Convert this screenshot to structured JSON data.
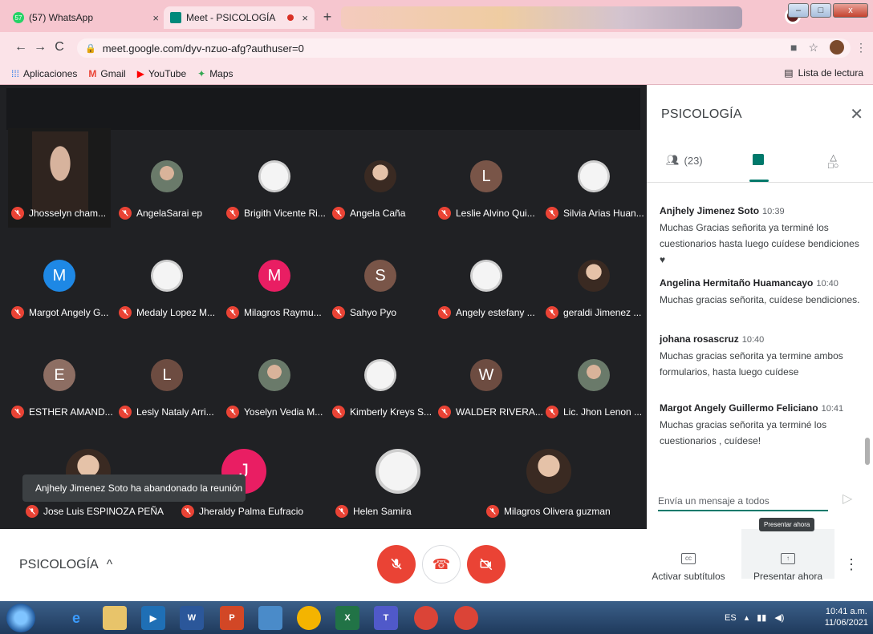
{
  "browser": {
    "tabs": [
      {
        "title": "(57) WhatsApp",
        "badge": "57"
      },
      {
        "title": "Meet - PSICOLOGÍA"
      }
    ],
    "url": "meet.google.com/dyv-nzuo-afg?authuser=0",
    "bookmarks": [
      "Aplicaciones",
      "Gmail",
      "YouTube",
      "Maps"
    ],
    "reading_list": "Lista de lectura"
  },
  "grid": {
    "rows": [
      [
        {
          "name": "Jhosselyn cham...",
          "avatar": "photo"
        },
        {
          "name": "AngelaSarai ep",
          "avatar": "photo"
        },
        {
          "name": "Brigith Vicente Ri...",
          "avatar": "photo"
        },
        {
          "name": "Angela Caña",
          "avatar": "photo"
        },
        {
          "name": "Leslie Alvino Qui...",
          "avatar": "letter",
          "letter": "L",
          "color": "#795548"
        },
        {
          "name": "Silvia Arias Huan...",
          "avatar": "photo"
        }
      ],
      [
        {
          "name": "Margot Angely G...",
          "avatar": "letter",
          "letter": "M",
          "color": "#1e88e5"
        },
        {
          "name": "Medaly Lopez M...",
          "avatar": "photo"
        },
        {
          "name": "Milagros Raymu...",
          "avatar": "letter",
          "letter": "M",
          "color": "#e91e63"
        },
        {
          "name": "Sahyo Pyo",
          "avatar": "letter",
          "letter": "S",
          "color": "#795548"
        },
        {
          "name": "Angely estefany ...",
          "avatar": "photo"
        },
        {
          "name": "geraldi Jimenez ...",
          "avatar": "photo"
        }
      ],
      [
        {
          "name": "ESTHER AMAND...",
          "avatar": "letter",
          "letter": "E",
          "color": "#8d6e63"
        },
        {
          "name": "Lesly Nataly Arri...",
          "avatar": "letter",
          "letter": "L",
          "color": "#6d4c41"
        },
        {
          "name": "Yoselyn Vedia M...",
          "avatar": "photo"
        },
        {
          "name": "Kimberly Kreys S...",
          "avatar": "photo"
        },
        {
          "name": "WALDER RIVERA...",
          "avatar": "letter",
          "letter": "W",
          "color": "#6d4c41"
        },
        {
          "name": "Lic. Jhon Lenon ...",
          "avatar": "photo"
        }
      ],
      [
        {
          "name": "Jose Luis ESPINOZA PEÑA",
          "avatar": "photo"
        },
        {
          "name": "Jheraldy Palma Eufracio",
          "avatar": "letter",
          "letter": "J",
          "color": "#e91e63"
        },
        {
          "name": "Helen Samira",
          "avatar": "photo"
        },
        {
          "name": "Milagros Olivera guzman",
          "avatar": "photo"
        }
      ]
    ],
    "toast": "Anjhely Jimenez Soto ha abandonado la reunión"
  },
  "panel": {
    "title": "PSICOLOGÍA",
    "people_count": "(23)",
    "messages": [
      {
        "who": "Anjhely Jimenez Soto",
        "time": "10:39",
        "text": "Muchas Gracias señorita ya terminé los cuestionarios hasta luego cuídese bendiciones ♥"
      },
      {
        "who": "Angelina Hermitaño Huamancayo",
        "time": "10:40",
        "text": "Muchas gracias señorita, cuídese bendiciones."
      },
      {
        "who": "johana rosascruz",
        "time": "10:40",
        "text": "Muchas gracias señorita ya termine  ambos formularios, hasta luego cuídese"
      },
      {
        "who": "Margot Angely Guillermo Feliciano",
        "time": "10:41",
        "text": "Muchas gracias señorita  ya terminé los cuestionarios , cuídese!"
      }
    ],
    "compose_placeholder": "Envía un mensaje a todos"
  },
  "bottom": {
    "meeting_name": "PSICOLOGÍA",
    "subtitles": "Activar subtítulos",
    "present": "Presentar ahora",
    "tooltip": "Presentar ahora"
  },
  "taskbar": {
    "lang": "ES",
    "time": "10:41 a.m.",
    "date": "11/06/2021"
  }
}
